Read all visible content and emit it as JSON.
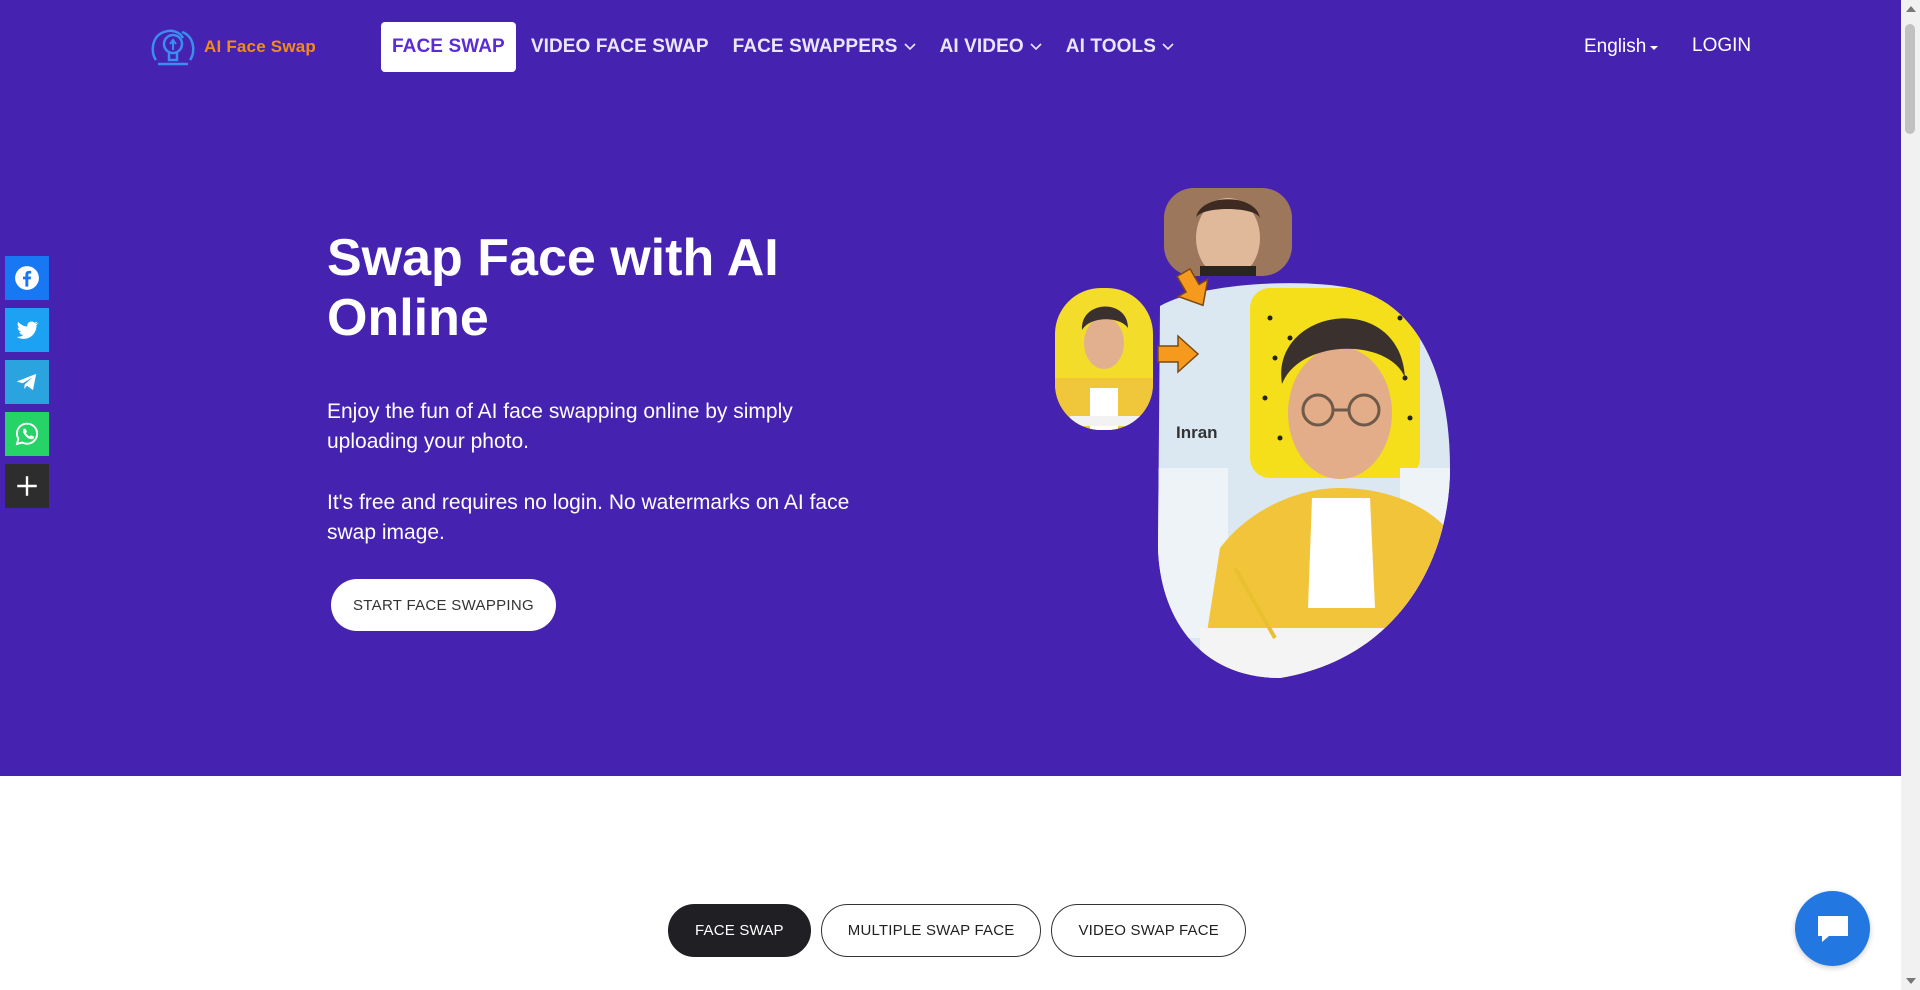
{
  "header": {
    "logo_text": "AI Face Swap",
    "nav": [
      {
        "label": "FACE SWAP",
        "active": true,
        "dropdown": false
      },
      {
        "label": "VIDEO FACE SWAP",
        "active": false,
        "dropdown": false
      },
      {
        "label": "FACE SWAPPERS",
        "active": false,
        "dropdown": true
      },
      {
        "label": "AI VIDEO",
        "active": false,
        "dropdown": true
      },
      {
        "label": "AI TOOLS",
        "active": false,
        "dropdown": true
      }
    ],
    "language": "English",
    "login": "LOGIN"
  },
  "hero": {
    "title": "Swap Face with AI Online",
    "paragraph1": "Enjoy the fun of AI face swapping online by simply uploading your photo.",
    "paragraph2": "It's free and requires no login. No watermarks on AI face swap image.",
    "cta": "START FACE SWAPPING",
    "artwork_label": "Inran"
  },
  "share_bar": {
    "items": [
      "facebook-icon",
      "twitter-icon",
      "telegram-icon",
      "whatsapp-icon",
      "plus-icon"
    ],
    "colors": {
      "facebook": "#1877f2",
      "twitter": "#1da1f2",
      "telegram": "#2aa3de",
      "whatsapp": "#25d366",
      "more": "#2d2d2d"
    }
  },
  "tabs": [
    {
      "label": "FACE SWAP",
      "active": true
    },
    {
      "label": "MULTIPLE SWAP FACE",
      "active": false
    },
    {
      "label": "VIDEO SWAP FACE",
      "active": false
    }
  ],
  "colors": {
    "hero_bg": "#4522b0",
    "accent": "#5a2bd6",
    "logo": "#f28a1c",
    "chat": "#2278e0"
  }
}
